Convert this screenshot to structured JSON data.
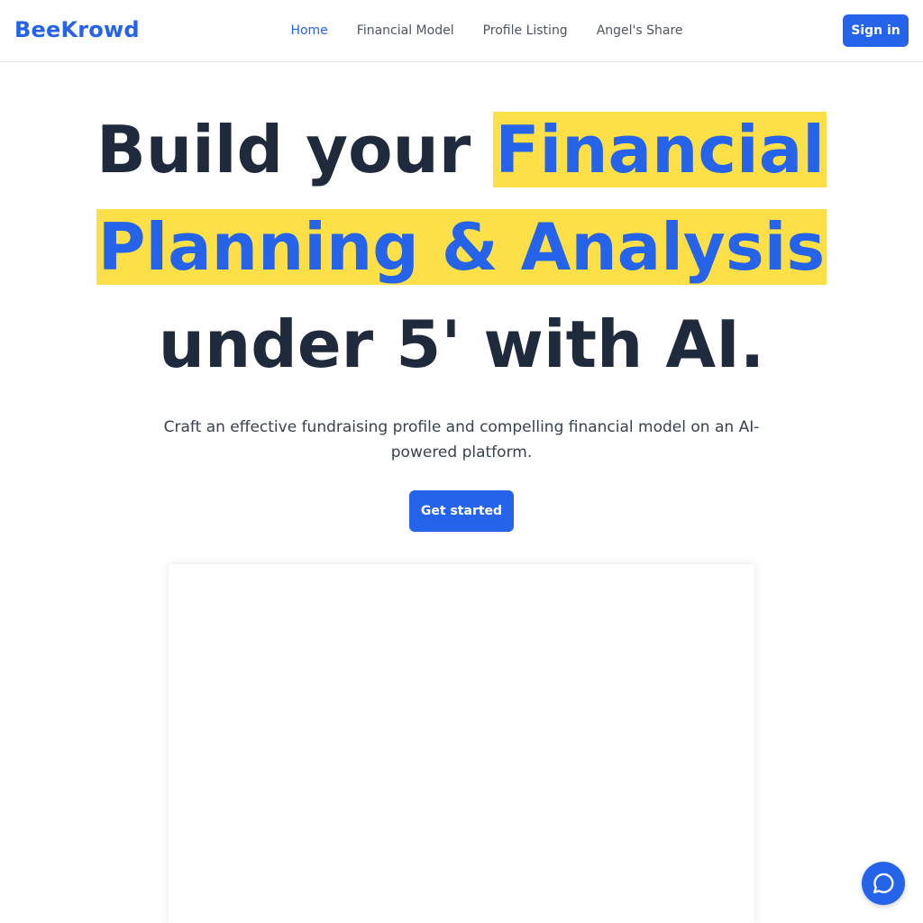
{
  "header": {
    "logo": "BeeKrowd",
    "nav": [
      {
        "label": "Home",
        "active": true
      },
      {
        "label": "Financial Model",
        "active": false
      },
      {
        "label": "Profile Listing",
        "active": false
      },
      {
        "label": "Angel's Share",
        "active": false
      }
    ],
    "signin_label": "Sign in"
  },
  "hero": {
    "title_part1": "Build your ",
    "title_highlight_1": "Financial",
    "title_highlight_2": "Planning & Analysis",
    "title_part3": "under 5' with AI.",
    "subtitle": "Craft an effective fundraising profile and compelling financial model on an AI-powered platform.",
    "cta_label": "Get started"
  },
  "colors": {
    "brand_blue": "#2563eb",
    "highlight_yellow": "#fde047",
    "heading_dark": "#1f2a3c"
  },
  "icons": {
    "chat": "chat-bubble-icon"
  }
}
